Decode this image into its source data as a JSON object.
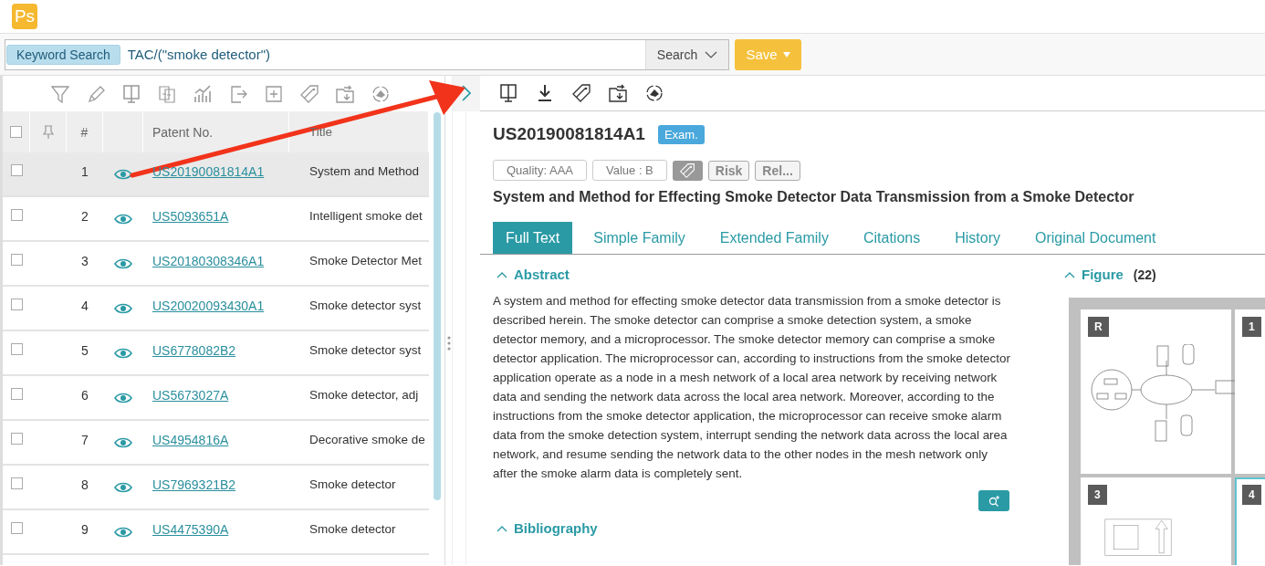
{
  "app": {
    "logo_text": "Ps"
  },
  "search": {
    "field_label": "Keyword Search",
    "query": "TAC/(\"smoke detector\")",
    "search_button": "Search",
    "save_button": "Save"
  },
  "results": {
    "select_all_checked": false,
    "columns": [
      "#",
      "Patent No.",
      "Title"
    ],
    "rows": [
      {
        "number": "1",
        "patent_no": "US20190081814A1",
        "title": "System and Method",
        "selected": true,
        "checked": false
      },
      {
        "number": "2",
        "patent_no": "US5093651A",
        "title": "Intelligent smoke det",
        "selected": false,
        "checked": false
      },
      {
        "number": "3",
        "patent_no": "US20180308346A1",
        "title": "Smoke Detector Met",
        "selected": false,
        "checked": false
      },
      {
        "number": "4",
        "patent_no": "US20020093430A1",
        "title": "Smoke detector syst",
        "selected": false,
        "checked": false
      },
      {
        "number": "5",
        "patent_no": "US6778082B2",
        "title": "Smoke detector syst",
        "selected": false,
        "checked": false
      },
      {
        "number": "6",
        "patent_no": "US5673027A",
        "title": "Smoke detector, adj",
        "selected": false,
        "checked": false
      },
      {
        "number": "7",
        "patent_no": "US4954816A",
        "title": "Decorative smoke de",
        "selected": false,
        "checked": false
      },
      {
        "number": "8",
        "patent_no": "US7969321B2",
        "title": "Smoke detector",
        "selected": false,
        "checked": false
      },
      {
        "number": "9",
        "patent_no": "US4475390A",
        "title": "Smoke detector",
        "selected": false,
        "checked": false
      }
    ]
  },
  "detail": {
    "patent_no": "US20190081814A1",
    "status_badge": "Exam.",
    "quality": "Quality:  AAA",
    "value": "Value : B",
    "risk": "Risk",
    "related": "Rel...",
    "title": "System and Method for Effecting Smoke Detector Data Transmission from a Smoke Detector",
    "tabs": [
      {
        "label": "Full Text",
        "selected": true
      },
      {
        "label": "Simple Family",
        "selected": false
      },
      {
        "label": "Extended Family",
        "selected": false
      },
      {
        "label": "Citations",
        "selected": false
      },
      {
        "label": "History",
        "selected": false
      },
      {
        "label": "Original Document",
        "selected": false
      }
    ],
    "abstract": {
      "heading": "Abstract",
      "text": "A system and method for effecting smoke detector data transmission from a smoke detector is described herein. The smoke detector can comprise a smoke detection system, a smoke detector memory, and a microprocessor. The smoke detector memory can comprise a smoke detector application. The microprocessor can, according to instructions from the smoke detector application operate as a node in a mesh network of a local area network by receiving network data and sending the network data across the local area network. Moreover, according to the instructions from the smoke detector application, the microprocessor can receive smoke alarm data from the smoke detection system, interrupt sending the network data across the local area network, and resume sending the network data to the other nodes in the mesh network only after the smoke alarm data is completely sent."
    },
    "figure": {
      "heading": "Figure",
      "count": "(22)",
      "thumbnails": [
        {
          "label": "R",
          "selected": false
        },
        {
          "label": "1",
          "selected": false
        },
        {
          "label": "3",
          "selected": false
        },
        {
          "label": "4",
          "selected": true
        }
      ]
    },
    "bibliography": "Bibliography"
  }
}
